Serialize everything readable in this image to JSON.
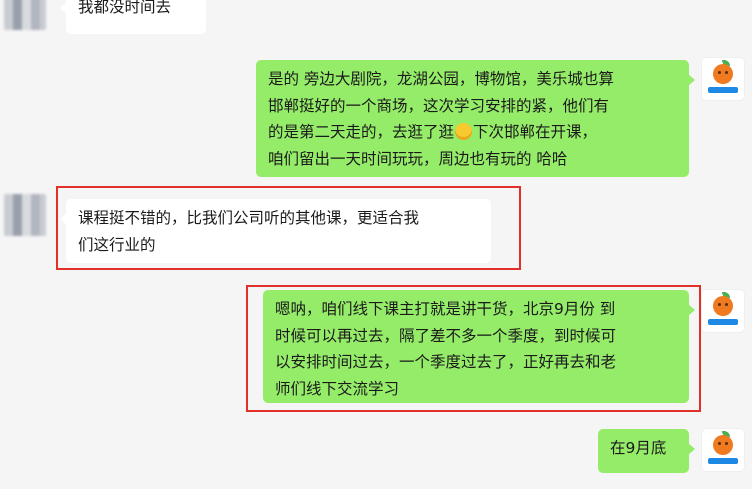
{
  "messages": [
    {
      "side": "left",
      "text": "我都没时间去"
    },
    {
      "side": "right",
      "lines": [
        "是的 旁边大剧院，龙湖公园，博物馆，美乐城也算",
        "邯郸挺好的一个商场，这次学习安排的紧，他们有",
        "的是第二天走的，去逛了逛",
        "下次邯郸在开课，",
        "咱们留出一天时间玩玩，周边也有玩的 哈哈"
      ],
      "emoji": "grinning-emoji"
    },
    {
      "side": "left",
      "lines": [
        "课程挺不错的，比我们公司听的其他课，更适合我",
        "们这行业的"
      ]
    },
    {
      "side": "right",
      "lines": [
        "嗯呐，咱们线下课主打就是讲干货，北京9月份 到",
        "时候可以再过去，隔了差不多一个季度，到时候可",
        "以安排时间过去，一个季度过去了，正好再去和老",
        "师们线下交流学习"
      ]
    },
    {
      "side": "right",
      "text": "在9月底"
    }
  ],
  "colors": {
    "background": "#f5f5f5",
    "self_bubble": "#95ec69",
    "other_bubble": "#ffffff",
    "highlight": "#e0302a"
  }
}
